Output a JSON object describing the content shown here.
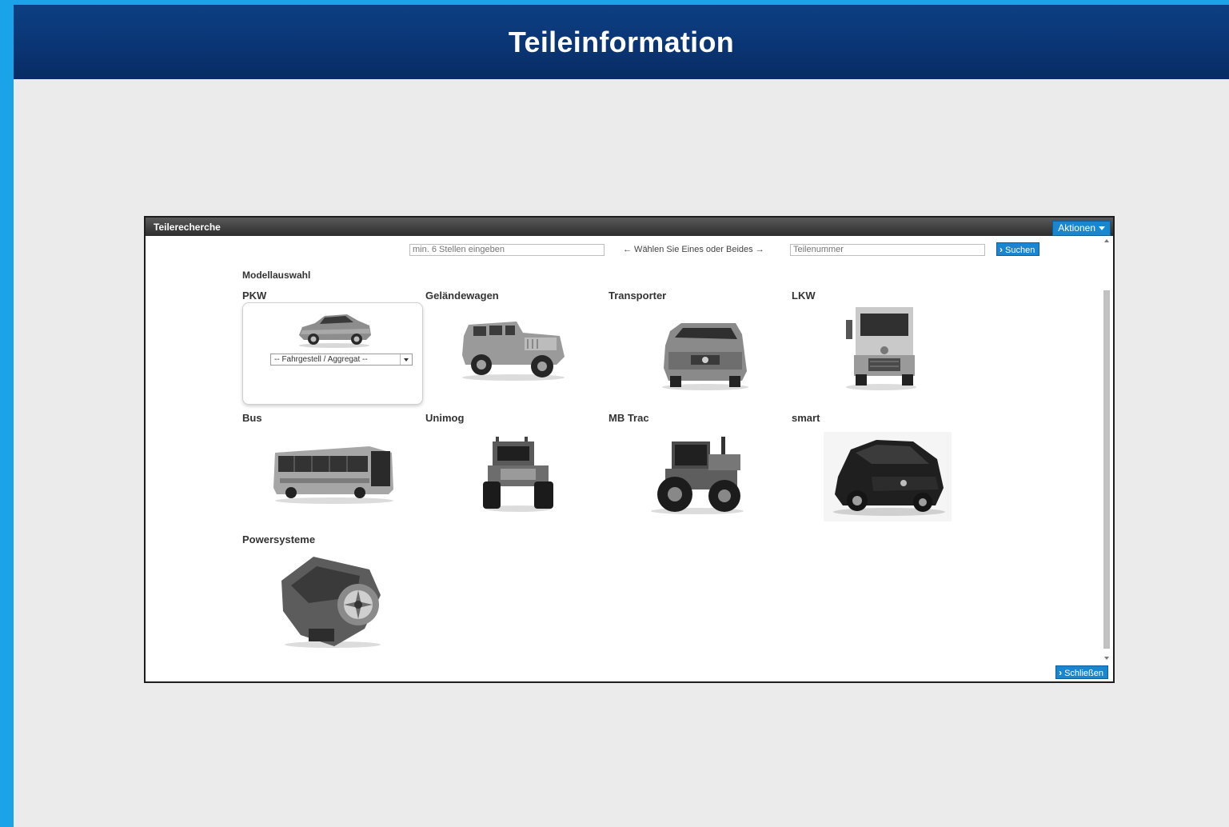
{
  "header": {
    "title": "Teileinformation"
  },
  "dialog": {
    "title": "Teilerecherche",
    "actions_label": "Aktionen",
    "search": {
      "vin_placeholder": "min. 6 Stellen eingeben",
      "hint": "← Wählen Sie Eines oder Beides →",
      "part_placeholder": "Teilenummer",
      "search_label": "Suchen"
    },
    "section_title": "Modellauswahl",
    "categories": [
      {
        "label": "PKW",
        "icon": "car-suv-icon"
      },
      {
        "label": "Geländewagen",
        "icon": "offroad-icon"
      },
      {
        "label": "Transporter",
        "icon": "van-icon"
      },
      {
        "label": "LKW",
        "icon": "truck-icon"
      },
      {
        "label": "Bus",
        "icon": "bus-icon"
      },
      {
        "label": "Unimog",
        "icon": "unimog-icon"
      },
      {
        "label": "MB Trac",
        "icon": "tractor-icon"
      },
      {
        "label": "smart",
        "icon": "smart-car-icon"
      },
      {
        "label": "Powersysteme",
        "icon": "engine-icon"
      }
    ],
    "pkw_select_value": "-- Fahrgestell / Aggregat --",
    "close_label": "Schließen"
  },
  "colors": {
    "accent": "#1a86cf",
    "header": "#0a3574",
    "frame": "#1aa3e8"
  }
}
